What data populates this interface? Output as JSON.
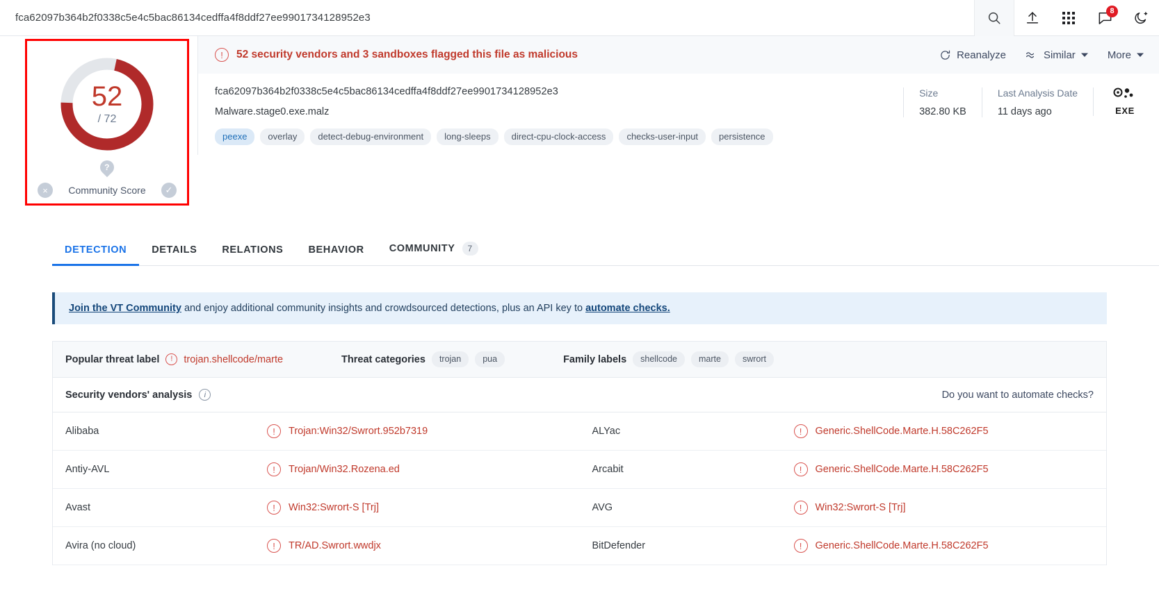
{
  "topbar": {
    "hash": "fca62097b364b2f0338c5e4c5bac86134cedffa4f8ddf27ee9901734128952e3",
    "notification_count": "8",
    "icons": [
      "search-icon",
      "upload-icon",
      "apps-grid-icon",
      "comment-icon",
      "dark-mode-icon"
    ]
  },
  "score": {
    "detections": "52",
    "total": "/ 72",
    "community_label": "Community Score",
    "vote_down": "×",
    "vote_up": "✓",
    "help": "?",
    "ring_color": "#c0392b"
  },
  "alert": {
    "message": "52 security vendors and 3 sandboxes flagged this file as malicious",
    "reanalyze": "Reanalyze",
    "similar": "Similar",
    "more": "More"
  },
  "file": {
    "hash": "fca62097b364b2f0338c5e4c5bac86134cedffa4f8ddf27ee9901734128952e3",
    "name": "Malware.stage0.exe.malz",
    "tags": [
      {
        "label": "peexe",
        "highlighted": true
      },
      {
        "label": "overlay",
        "highlighted": false
      },
      {
        "label": "detect-debug-environment",
        "highlighted": false
      },
      {
        "label": "long-sleeps",
        "highlighted": false
      },
      {
        "label": "direct-cpu-clock-access",
        "highlighted": false
      },
      {
        "label": "checks-user-input",
        "highlighted": false
      },
      {
        "label": "persistence",
        "highlighted": false
      }
    ],
    "size_label": "Size",
    "size_value": "382.80 KB",
    "date_label": "Last Analysis Date",
    "date_value": "11 days ago",
    "file_type": "EXE"
  },
  "tabs": [
    {
      "label": "DETECTION",
      "active": true,
      "count": null
    },
    {
      "label": "DETAILS",
      "active": false,
      "count": null
    },
    {
      "label": "RELATIONS",
      "active": false,
      "count": null
    },
    {
      "label": "BEHAVIOR",
      "active": false,
      "count": null
    },
    {
      "label": "COMMUNITY",
      "active": false,
      "count": "7"
    }
  ],
  "community_banner": {
    "link1": "Join the VT Community",
    "middle": " and enjoy additional community insights and crowdsourced detections, plus an API key to ",
    "link2": "automate checks."
  },
  "threat": {
    "popular_label": "Popular threat label",
    "popular_value": "trojan.shellcode/marte",
    "categories_label": "Threat categories",
    "categories": [
      "trojan",
      "pua"
    ],
    "family_label": "Family labels",
    "families": [
      "shellcode",
      "marte",
      "swrort"
    ]
  },
  "vendors": {
    "title": "Security vendors' analysis",
    "automate_text": "Do you want to automate checks?",
    "left_rows": [
      {
        "vendor": "Alibaba",
        "result": "Trojan:Win32/Swrort.952b7319"
      },
      {
        "vendor": "Antiy-AVL",
        "result": "Trojan/Win32.Rozena.ed"
      },
      {
        "vendor": "Avast",
        "result": "Win32:Swrort-S [Trj]"
      },
      {
        "vendor": "Avira (no cloud)",
        "result": "TR/AD.Swrort.wwdjx"
      }
    ],
    "right_rows": [
      {
        "vendor": "ALYac",
        "result": "Generic.ShellCode.Marte.H.58C262F5"
      },
      {
        "vendor": "Arcabit",
        "result": "Generic.ShellCode.Marte.H.58C262F5"
      },
      {
        "vendor": "AVG",
        "result": "Win32:Swrort-S [Trj]"
      },
      {
        "vendor": "BitDefender",
        "result": "Generic.ShellCode.Marte.H.58C262F5"
      }
    ]
  }
}
